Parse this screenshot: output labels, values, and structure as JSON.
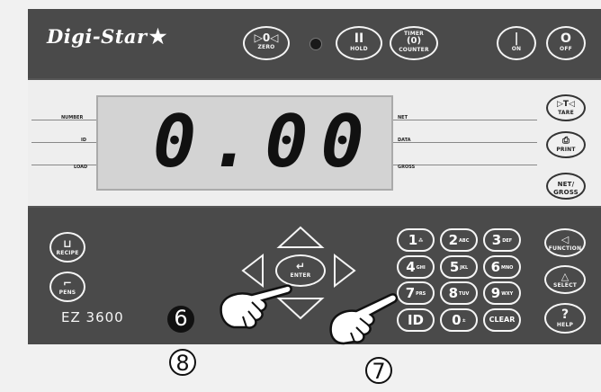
{
  "brand": {
    "name": "Digi-Star",
    "star": "★"
  },
  "model": "EZ 3600",
  "display": {
    "value": "0.00"
  },
  "indicators_left": [
    "NUMBER",
    "ID",
    "LOAD"
  ],
  "indicators_right": [
    "NET",
    "DATA",
    "GROSS"
  ],
  "top_buttons": {
    "zero": {
      "icon": "▷0◁",
      "label": "ZERO"
    },
    "hold": {
      "icon": "II",
      "label": "HOLD"
    },
    "timer": {
      "icon": "(0)",
      "label": "COUNTER",
      "top": "TIMER"
    },
    "on": {
      "icon": "|",
      "label": "ON"
    },
    "off": {
      "icon": "O",
      "label": "OFF"
    }
  },
  "side_buttons": {
    "tare": {
      "icon": "▷T◁",
      "label": "TARE"
    },
    "print": {
      "icon": "⎙",
      "label": "PRINT"
    },
    "netgross": {
      "icon": "NET/",
      "label": "GROSS"
    }
  },
  "left_buttons": {
    "recipe": {
      "icon": "⊔",
      "label": "RECIPE"
    },
    "pens": {
      "icon": "⌐",
      "label": "PENS"
    }
  },
  "nav": {
    "enter_label": "ENTER",
    "enter_icon": "↵"
  },
  "keypad": [
    {
      "digit": "1",
      "sub": "⁂"
    },
    {
      "digit": "2",
      "sub": "ABC"
    },
    {
      "digit": "3",
      "sub": "DEF"
    },
    {
      "digit": "4",
      "sub": "GHI"
    },
    {
      "digit": "5",
      "sub": "JKL"
    },
    {
      "digit": "6",
      "sub": "MNO"
    },
    {
      "digit": "7",
      "sub": "PRS"
    },
    {
      "digit": "8",
      "sub": "TUV"
    },
    {
      "digit": "9",
      "sub": "WXY"
    },
    {
      "digit": "ID",
      "sub": ""
    },
    {
      "digit": "0",
      "sub": "±"
    },
    {
      "digit": "CLEAR",
      "sub": ""
    }
  ],
  "right_col": {
    "function": {
      "icon": "◁",
      "label": "FUNCTION"
    },
    "select": {
      "icon": "△",
      "label": "SELECT"
    },
    "help": {
      "icon": "?",
      "label": "HELP"
    }
  },
  "callouts": [
    "6",
    "8",
    "7"
  ]
}
